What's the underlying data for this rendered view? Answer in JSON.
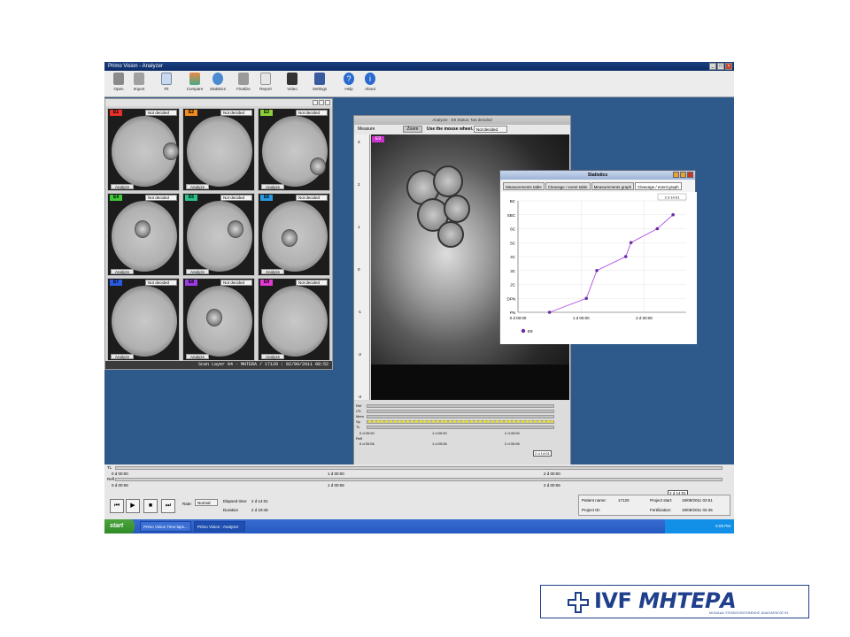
{
  "window": {
    "title": "Primo Vision - Analyzer"
  },
  "toolbar": {
    "items": [
      "Open",
      "Import",
      "Fit",
      "Compare",
      "Statistics",
      "Finalize",
      "Report",
      "Video",
      "Settings",
      "Help",
      "About"
    ]
  },
  "grid": {
    "cells": [
      {
        "tag": "E1",
        "color": "#e8302a",
        "status": "Not decided",
        "action": "Analyze"
      },
      {
        "tag": "E2",
        "color": "#f28a1c",
        "status": "Not decided",
        "action": "Analyze"
      },
      {
        "tag": "E3",
        "color": "#8ad13a",
        "status": "Not decided",
        "action": "Analyze"
      },
      {
        "tag": "E4",
        "color": "#3fc63a",
        "status": "Not decided",
        "action": "Analyze"
      },
      {
        "tag": "E5",
        "color": "#2ac28a",
        "status": "Not decided",
        "action": "Analyze"
      },
      {
        "tag": "E6",
        "color": "#2a9ae0",
        "status": "Not decided",
        "action": "Analyze"
      },
      {
        "tag": "E7",
        "color": "#2a5ae0",
        "status": "Not decided",
        "action": "Analyze"
      },
      {
        "tag": "E8",
        "color": "#9a3ae0",
        "status": "Not decided",
        "action": "Analyze"
      },
      {
        "tag": "E9",
        "color": "#e03ad0",
        "status": "Not decided",
        "action": "Analyze"
      }
    ],
    "status_bar": "Scan Layer 04 - MHTERA / 17120 : 02/09/2011 08:52"
  },
  "analyzer": {
    "title": "Analyzer : E9      Status: Not decided",
    "measure_label": "Measure",
    "zoom_label": "Zoom",
    "zoom_hint": "Use the mouse wheel.",
    "decision": "Not decided",
    "embryo_tag": "E9",
    "ruler": [
      "3",
      "2",
      "1",
      "0",
      "-1",
      "-2",
      "-3"
    ],
    "track_labels": [
      "Ref",
      "CS",
      "Mem",
      "Sp",
      "TL",
      "Refl"
    ],
    "track_times_top": [
      "0 d 00:00",
      "1 d 00:00",
      "2 d 00:00"
    ],
    "track_times_bottom": [
      "0 d 00:06",
      "1 d 00:06",
      "2 d 00:06"
    ],
    "marker": "2 d 14:01",
    "stages": [
      {
        "label": "PN",
        "color": "#f4a0c0"
      },
      {
        "label": "DPN",
        "color": "#f078c0"
      },
      {
        "label": "2C",
        "color": "#f4f040"
      },
      {
        "label": "3C",
        "color": "#f4c040"
      },
      {
        "label": "4C",
        "color": "#f08030"
      },
      {
        "label": "5C",
        "color": "#e03030"
      },
      {
        "label": "6C",
        "color": "#c02080"
      },
      {
        "label": "8C",
        "color": "#3040e0"
      },
      {
        "label": "SBC",
        "color": "#40c040"
      },
      {
        "label": "BC",
        "color": "#30a030"
      }
    ]
  },
  "statistics": {
    "title": "Statistics",
    "tabs": [
      "Measurements table",
      "Cleavage / event table",
      "Measurements graph",
      "Cleavage / event graph"
    ],
    "active_tab": 3,
    "readout": "2 d 14:01",
    "legend": "E9"
  },
  "chart_data": {
    "type": "line",
    "y_categories": [
      "PN",
      "DPN",
      "2C",
      "3C",
      "4C",
      "5C",
      "6C",
      "SBC",
      "BC"
    ],
    "x_ticks": [
      "0 d 00:00",
      "1 d 00:00",
      "2 d 00:00"
    ],
    "xlim_hours": [
      0,
      64
    ],
    "series": [
      {
        "name": "E9",
        "color": "#b050e0",
        "points": [
          {
            "x_hours": 12,
            "y": "PN"
          },
          {
            "x_hours": 26,
            "y": "DPN"
          },
          {
            "x_hours": 30,
            "y": "3C"
          },
          {
            "x_hours": 41,
            "y": "4C"
          },
          {
            "x_hours": 43,
            "y": "5C"
          },
          {
            "x_hours": 53,
            "y": "6C"
          },
          {
            "x_hours": 59,
            "y": "SBC"
          }
        ]
      }
    ]
  },
  "timeline": {
    "labels": [
      "TL",
      "Refl"
    ],
    "times_top": [
      "0 d 00:00",
      "1 d 00:00",
      "2 d 00:00"
    ],
    "times_bottom": [
      "0 d 00:06",
      "1 d 00:06",
      "2 d 00:06"
    ],
    "marker": "2 d 14:01"
  },
  "playback": {
    "rate_label": "Rate:",
    "rate_value": "Normal",
    "elapsed_label": "Elapsed time:",
    "elapsed_value": "2 d 14:01",
    "duration_label": "Duration",
    "duration_value": "2 d 19:45"
  },
  "project": {
    "patient_label": "Patient name:",
    "patient_value": "17120",
    "project_id_label": "Project ID:",
    "project_start_label": "Project start:",
    "project_start_value": "19/09/2011 02:51",
    "fertilization_label": "Fertilization:",
    "fertilization_value": "19/09/2011 02:45"
  },
  "taskbar": {
    "start": "start",
    "tasks": [
      "Primo Vision Time-laps...",
      "Primo Vision - Analyzer"
    ],
    "clock": "6:09 PM"
  },
  "logo": {
    "word_a": "IVF",
    "word_b": "ΜΗΤΕΡΑ",
    "subtitle": "ΜΟΝΑΔΑ ΥΠΟΒΟΗΘΟΥΜΕΝΗΣ ΑΝΑΠΑΡΑΓΩΓΗΣ",
    "color": "#1f3f8c"
  }
}
